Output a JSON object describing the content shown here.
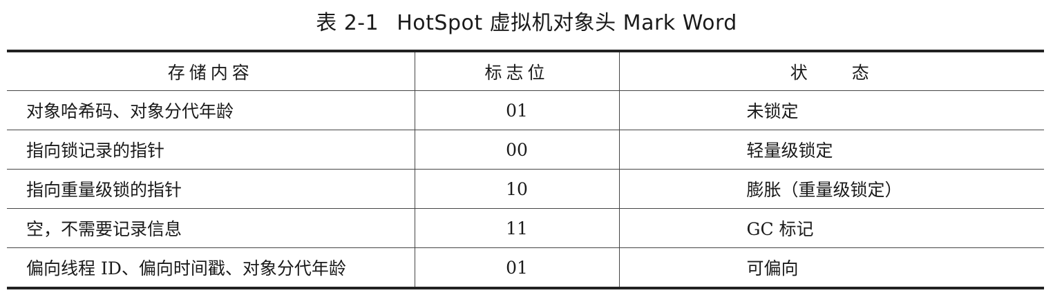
{
  "title": {
    "number": "表 2-1",
    "text": "HotSpot 虚拟机对象头 Mark Word"
  },
  "table": {
    "headers": {
      "content": "存储内容",
      "flag": "标志位",
      "state_a": "状",
      "state_b": "态"
    },
    "rows": [
      {
        "content": "对象哈希码、对象分代年龄",
        "flag": "01",
        "state": "未锁定"
      },
      {
        "content": "指向锁记录的指针",
        "flag": "00",
        "state": "轻量级锁定"
      },
      {
        "content": "指向重量级锁的指针",
        "flag": "10",
        "state": "膨胀（重量级锁定）"
      },
      {
        "content": "空，不需要记录信息",
        "flag": "11",
        "state": "GC 标记"
      },
      {
        "content": "偏向线程 ID、偏向时间戳、对象分代年龄",
        "flag": "01",
        "state": "可偏向"
      }
    ]
  }
}
